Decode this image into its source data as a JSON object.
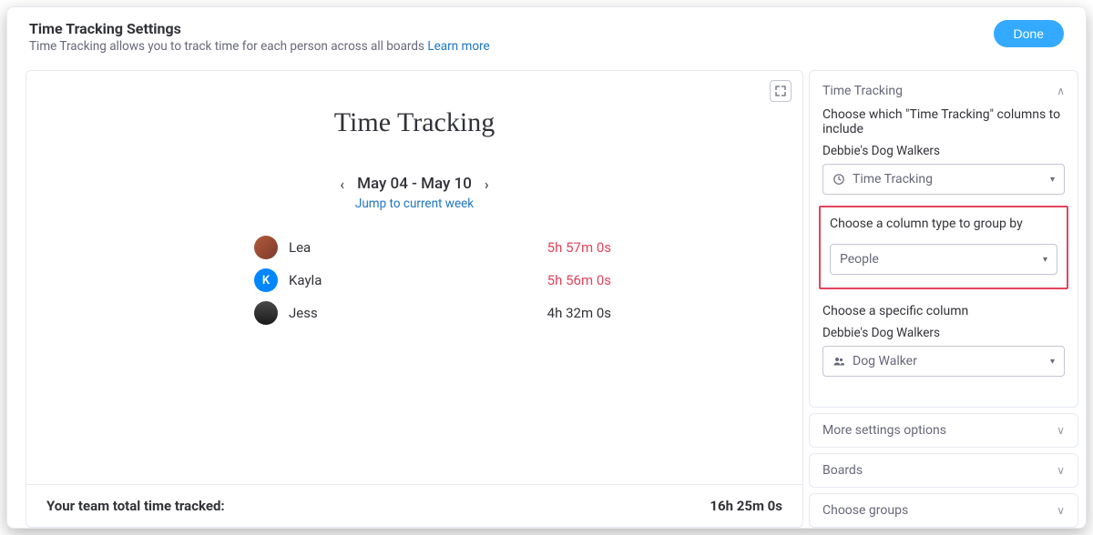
{
  "header": {
    "title": "Time Tracking Settings",
    "subtitle": "Time Tracking allows you to track time for each person across all boards ",
    "learn_more": "Learn more",
    "done": "Done"
  },
  "main": {
    "title": "Time Tracking",
    "range": "May 04 - May 10",
    "jump": "Jump to current week",
    "rows": [
      {
        "name": "Lea",
        "time": "5h 57m 0s",
        "emph": true,
        "avatar": "lea",
        "initial": ""
      },
      {
        "name": "Kayla",
        "time": "5h 56m 0s",
        "emph": true,
        "avatar": "kayla",
        "initial": "K"
      },
      {
        "name": "Jess",
        "time": "4h 32m 0s",
        "emph": false,
        "avatar": "jess",
        "initial": ""
      }
    ],
    "footer_label": "Your team total time tracked:",
    "footer_total": "16h 25m 0s"
  },
  "sidebar": {
    "panel_title": "Time Tracking",
    "sec1_label": "Choose which \"Time Tracking\" columns to include",
    "sec1_board": "Debbie's Dog Walkers",
    "sec1_select": "Time Tracking",
    "sec2_label": "Choose a column type to group by",
    "sec2_select": "People",
    "sec3_label": "Choose a specific column",
    "sec3_board": "Debbie's Dog Walkers",
    "sec3_select": "Dog Walker",
    "more_settings": "More settings options",
    "boards": "Boards",
    "choose_groups": "Choose groups"
  }
}
